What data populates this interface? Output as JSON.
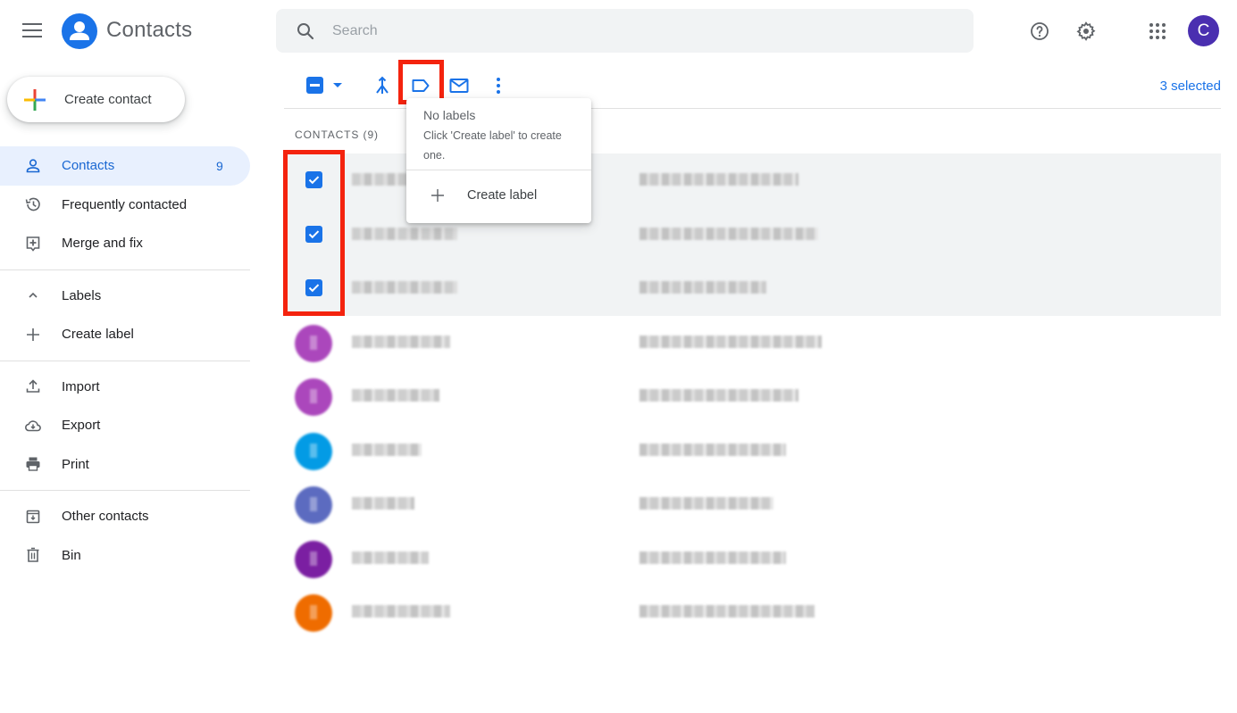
{
  "header": {
    "app_title": "Contacts",
    "search_placeholder": "Search",
    "search_value": "",
    "user_initial": "C",
    "icons": [
      "menu-icon",
      "contacts-logo-icon",
      "search-icon",
      "help-icon",
      "settings-gear-icon",
      "apps-grid-icon"
    ]
  },
  "sidebar": {
    "create_contact_label": "Create contact",
    "items": [
      {
        "label": "Contacts",
        "count": "9",
        "icon": "person-icon",
        "active": true
      },
      {
        "label": "Frequently contacted",
        "icon": "history-icon"
      },
      {
        "label": "Merge and fix",
        "icon": "merge-fix-icon"
      },
      {
        "label": "Labels",
        "icon": "chevron-up-icon"
      },
      {
        "label": "Create label",
        "icon": "plus-icon"
      },
      {
        "label": "Import",
        "icon": "upload-icon"
      },
      {
        "label": "Export",
        "icon": "cloud-download-icon"
      },
      {
        "label": "Print",
        "icon": "printer-icon"
      },
      {
        "label": "Other contacts",
        "icon": "archive-icon"
      },
      {
        "label": "Bin",
        "icon": "trash-icon"
      }
    ]
  },
  "toolbar": {
    "selected_count": "3 selected",
    "icons": [
      "select-checkbox-indeterminate",
      "select-dropdown-caret",
      "merge-icon",
      "label-icon",
      "email-icon",
      "more-vert-icon"
    ]
  },
  "list": {
    "header": "CONTACTS (9)",
    "rows": [
      {
        "selected": true,
        "avatar_color": null,
        "name": "[blurred]",
        "email": "[blurred]"
      },
      {
        "selected": true,
        "avatar_color": null,
        "name": "[blurred]",
        "email": "[blurred]"
      },
      {
        "selected": true,
        "avatar_color": null,
        "name": "[blurred]",
        "email": "[blurred]"
      },
      {
        "selected": false,
        "avatar_color": "#ab47bc",
        "name": "[blurred]",
        "email": "[blurred]"
      },
      {
        "selected": false,
        "avatar_color": "#ab47bc",
        "name": "[blurred]",
        "email": "[blurred]"
      },
      {
        "selected": false,
        "avatar_color": "#039be5",
        "name": "[blurred]",
        "email": "[blurred]"
      },
      {
        "selected": false,
        "avatar_color": "#5c6bc0",
        "name": "[blurred]",
        "email": "[blurred]"
      },
      {
        "selected": false,
        "avatar_color": "#7b1fa2",
        "name": "[blurred]",
        "email": "[blurred]"
      },
      {
        "selected": false,
        "avatar_color": "#ef6c00",
        "name": "[blurred]",
        "email": "[blurred]"
      }
    ]
  },
  "label_menu": {
    "title": "No labels",
    "hint": "Click 'Create label' to create one.",
    "create_label": "Create label"
  },
  "colors": {
    "accent": "#1a73e8",
    "highlight_box": "#f4230e",
    "selected_row_bg": "#f1f3f4",
    "active_nav_bg": "#e8f0fe",
    "user_avatar": "#4a2fb0"
  }
}
